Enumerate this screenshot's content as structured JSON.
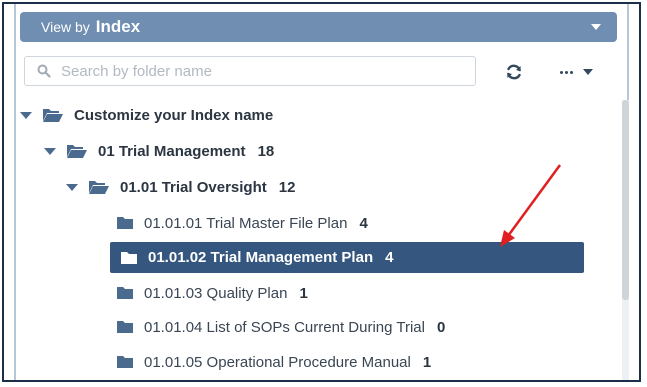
{
  "header": {
    "view_by_label": "View by",
    "view_by_value": "Index"
  },
  "search": {
    "placeholder": "Search by folder name"
  },
  "toolbar": {
    "refresh_icon": "refresh-icon",
    "more_icon": "more-options-icon"
  },
  "tree": {
    "root": {
      "label": "Customize your Index name"
    },
    "level1": {
      "label": "01 Trial Management",
      "count": "18"
    },
    "level2": {
      "label": "01.01 Trial Oversight",
      "count": "12"
    },
    "items": [
      {
        "label": "01.01.01 Trial Master File Plan",
        "count": "4"
      },
      {
        "label": "01.01.02 Trial Management Plan",
        "count": "4"
      },
      {
        "label": "01.01.03 Quality Plan",
        "count": "1"
      },
      {
        "label": "01.01.04 List of SOPs Current During Trial",
        "count": "0"
      },
      {
        "label": "01.01.05 Operational Procedure Manual",
        "count": "1"
      }
    ]
  },
  "colors": {
    "header_bg": "#6f8eb1",
    "selected_bg": "#35577f",
    "annotation_arrow": "#e02020"
  }
}
